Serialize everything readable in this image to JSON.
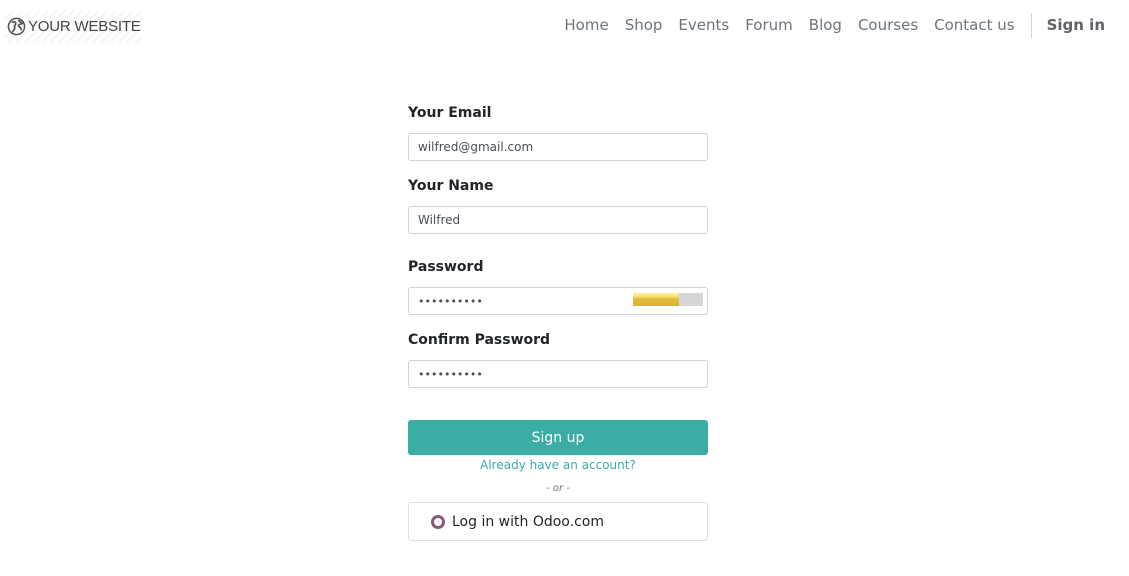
{
  "brand": {
    "logo_text": "YOUR WEBSITE",
    "logo_icon": "globe-icon"
  },
  "nav": {
    "items": [
      "Home",
      "Shop",
      "Events",
      "Forum",
      "Blog",
      "Courses",
      "Contact us"
    ],
    "sign_in": "Sign in"
  },
  "form": {
    "email_label": "Your Email",
    "email_value": "wilfred@gmail.com",
    "name_label": "Your Name",
    "name_value": "Wilfred",
    "password_label": "Password",
    "password_value": "••••••••••",
    "password_strength": 0.66,
    "confirm_label": "Confirm Password",
    "confirm_value": "••••••••••",
    "signup_label": "Sign up",
    "account_link": "Already have an account?",
    "or_text": "- or -",
    "odoo_login": "Log in with Odoo.com"
  },
  "colors": {
    "primary": "#3aada5",
    "odoo": "#875a7b",
    "strength": "#d9b332"
  }
}
